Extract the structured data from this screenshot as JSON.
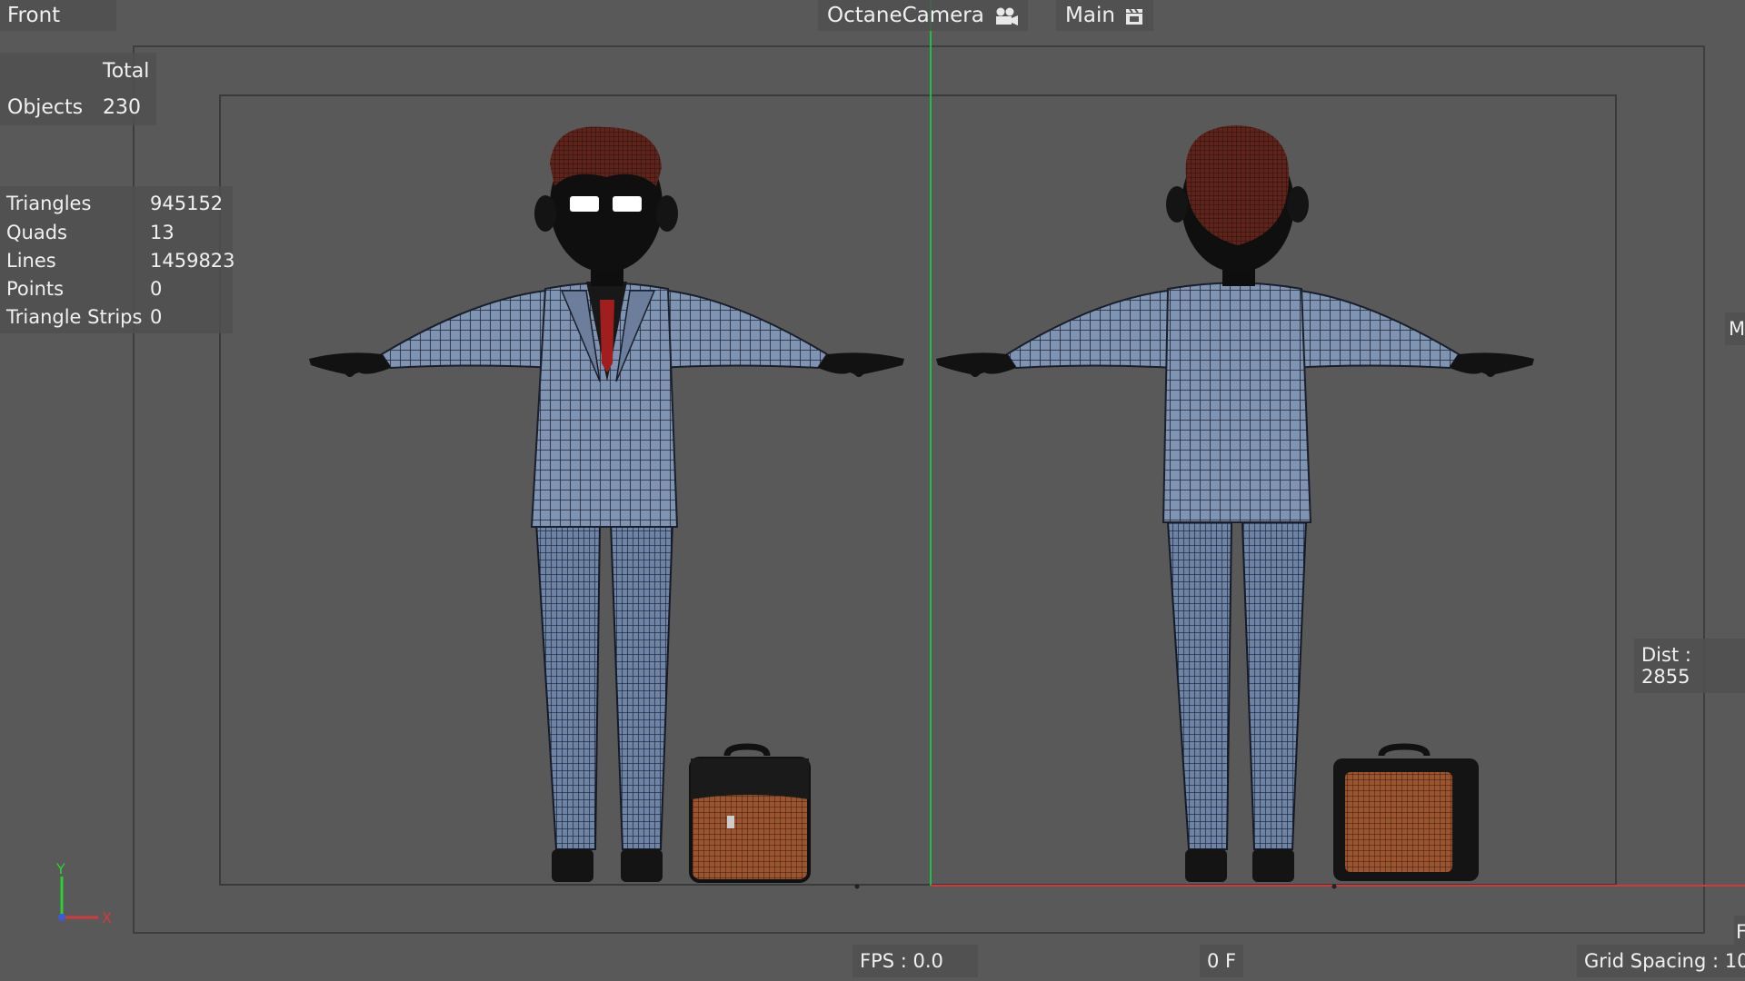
{
  "viewport": {
    "view_name": "Front",
    "camera_name": "OctaneCamera",
    "render_setting": "Main",
    "camera_icon": "camera-icon",
    "clapper_icon": "clapperboard-icon"
  },
  "stats": {
    "total_header": "Total",
    "objects_label": "Objects",
    "objects_value": "230",
    "rows": [
      {
        "label": "Triangles",
        "value": "945152"
      },
      {
        "label": "Quads",
        "value": "13"
      },
      {
        "label": "Lines",
        "value": "1459823"
      },
      {
        "label": "Points",
        "value": "0"
      },
      {
        "label": "Triangle Strips",
        "value": "0"
      }
    ]
  },
  "hud": {
    "fps": "FPS : 0.0",
    "frame": "0 F",
    "grid_spacing": "Grid Spacing : 10",
    "dist": "Dist : 2855",
    "edge_right_top": "M",
    "edge_right_bottom": "F"
  },
  "axis": {
    "y_label": "Y",
    "x_label": "X"
  },
  "colors": {
    "background": "#595959",
    "suit": "#7d8fab",
    "hair": "#6a2d22",
    "bag": "#8a4a2a",
    "green_axis": "#1fbf3a",
    "red_axis": "#d23a3a"
  }
}
